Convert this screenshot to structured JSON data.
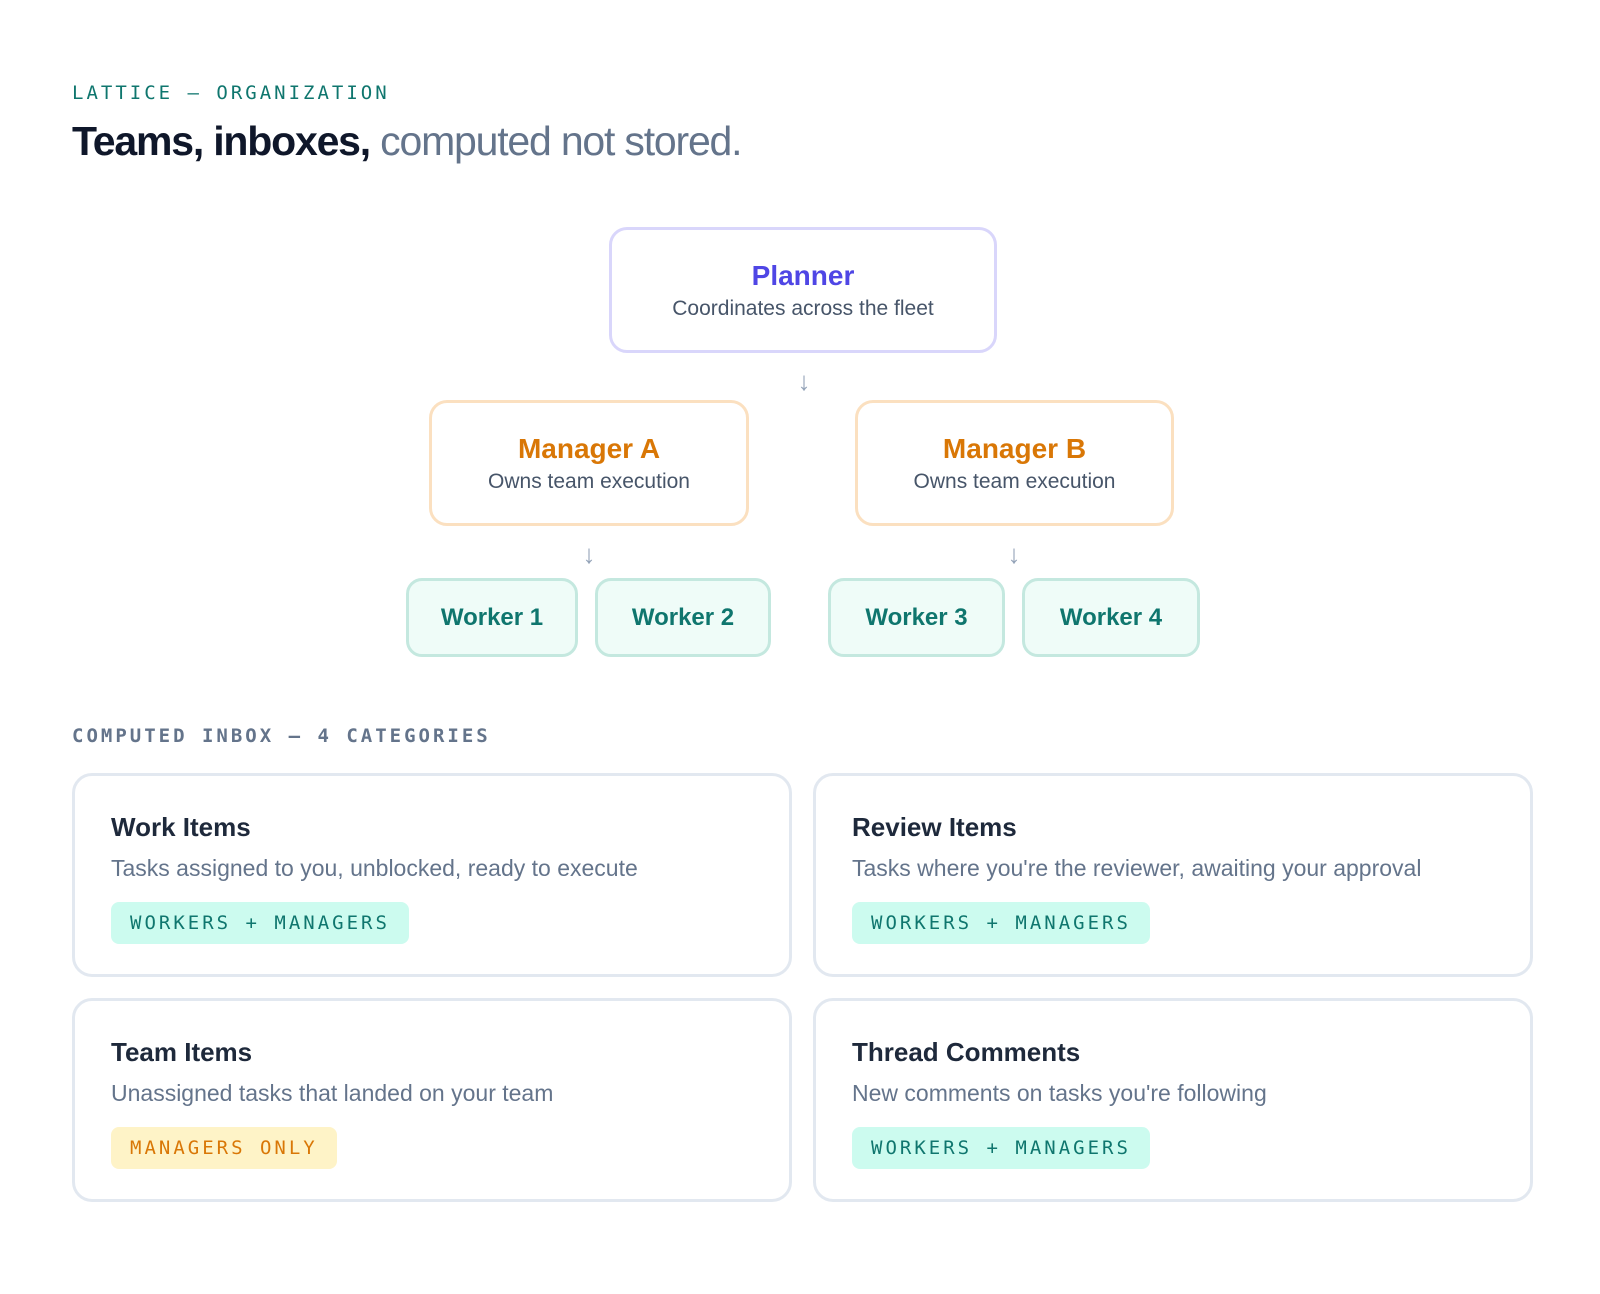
{
  "header": {
    "eyebrow": "LATTICE — ORGANIZATION",
    "headline_strong": "Teams, inboxes,",
    "headline_muted": "computed not stored."
  },
  "org": {
    "planner": {
      "title": "Planner",
      "subtitle": "Coordinates across the fleet"
    },
    "managers": [
      {
        "title": "Manager A",
        "subtitle": "Owns team execution"
      },
      {
        "title": "Manager B",
        "subtitle": "Owns team execution"
      }
    ],
    "workers": [
      "Worker 1",
      "Worker 2",
      "Worker 3",
      "Worker 4"
    ],
    "arrow_glyph": "↓"
  },
  "inbox": {
    "label": "COMPUTED INBOX — 4 CATEGORIES",
    "cards": [
      {
        "title": "Work Items",
        "description": "Tasks assigned to you, unblocked, ready to execute",
        "badge": "WORKERS + MANAGERS",
        "badge_color": "#ccfbef"
      },
      {
        "title": "Review Items",
        "description": "Tasks where you're the reviewer, awaiting your approval",
        "badge": "WORKERS + MANAGERS",
        "badge_color": "#ccfbef"
      },
      {
        "title": "Team Items",
        "description": "Unassigned tasks that landed on your team",
        "badge": "MANAGERS ONLY",
        "badge_color": "#fef3c7"
      },
      {
        "title": "Thread Comments",
        "description": "New comments on tasks you're following",
        "badge": "WORKERS + MANAGERS",
        "badge_color": "#ccfbef"
      }
    ]
  },
  "colors": {
    "planner": "#4f46e5",
    "manager": "#d97706",
    "worker": "#0f766e"
  }
}
